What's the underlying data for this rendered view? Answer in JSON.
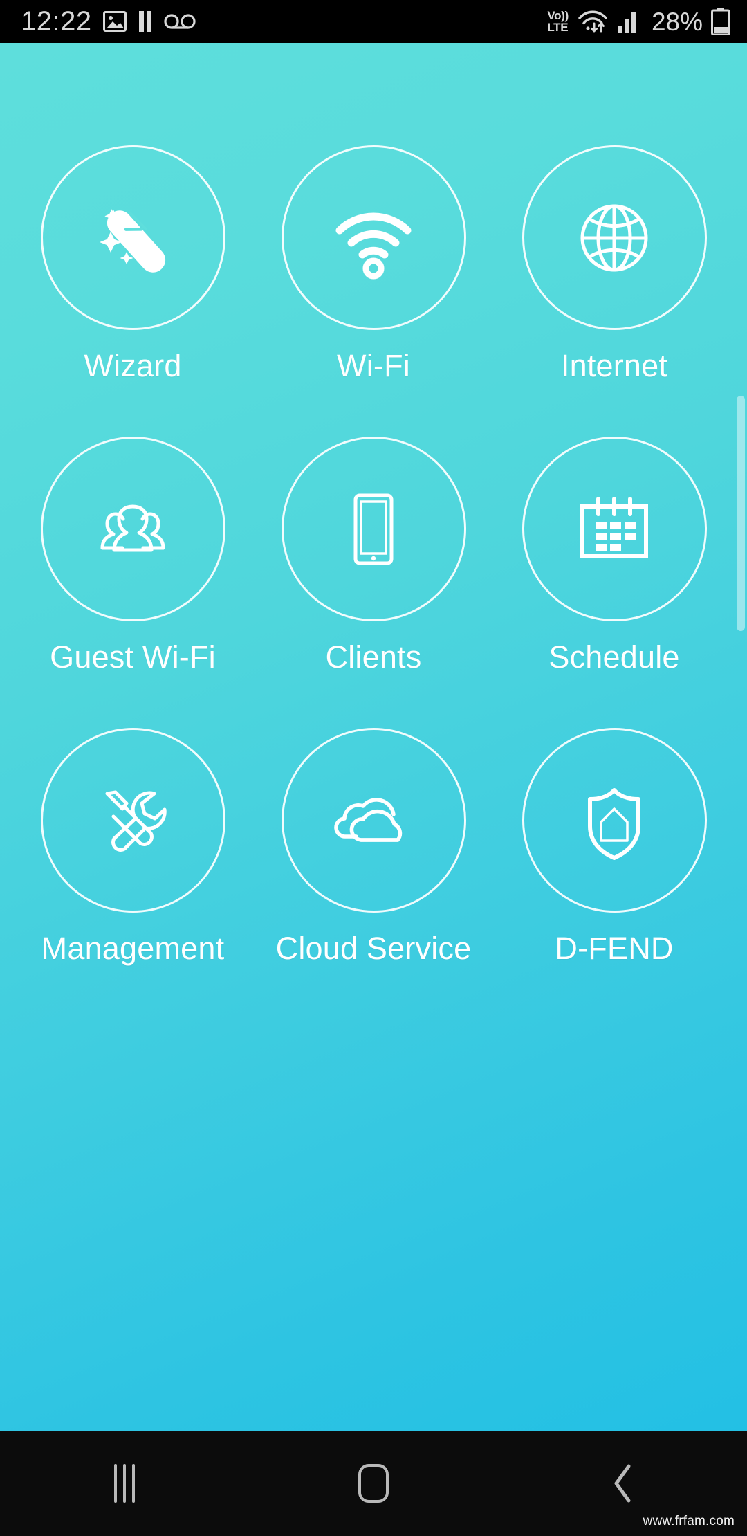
{
  "status_bar": {
    "clock": "12:22",
    "left_icons": [
      {
        "name": "screenshot-icon",
        "label": "Screenshot"
      },
      {
        "name": "media-pause-icon",
        "label": "Paused"
      },
      {
        "name": "voicemail-icon",
        "label": "Voicemail"
      }
    ],
    "volte": {
      "line1": "Vo))",
      "line2": "LTE"
    },
    "wifi_icon": "wifi-data-transfer-icon",
    "signal_icon": "cellular-signal-icon",
    "battery_percent": "28%",
    "battery_icon": "battery-icon"
  },
  "home": {
    "tiles": [
      {
        "id": "wizard",
        "label": "Wizard",
        "icon": "magic-wand-icon"
      },
      {
        "id": "wifi",
        "label": "Wi-Fi",
        "icon": "wifi-icon"
      },
      {
        "id": "internet",
        "label": "Internet",
        "icon": "globe-icon"
      },
      {
        "id": "guest-wifi",
        "label": "Guest Wi-Fi",
        "icon": "group-people-icon"
      },
      {
        "id": "clients",
        "label": "Clients",
        "icon": "tablet-device-icon"
      },
      {
        "id": "schedule",
        "label": "Schedule",
        "icon": "calendar-icon"
      },
      {
        "id": "management",
        "label": "Management",
        "icon": "tools-wrench-screwdriver-icon"
      },
      {
        "id": "cloud-service",
        "label": "Cloud Service",
        "icon": "clouds-icon"
      },
      {
        "id": "d-fend",
        "label": "D-FEND",
        "icon": "shield-home-icon"
      }
    ],
    "colors": {
      "gradient_top": "#5EDEDC",
      "gradient_bottom": "#23C0E4",
      "icon_stroke": "#FFFFFF",
      "label_color": "#FFFFFF"
    }
  },
  "nav_bar": {
    "recent_label": "Recent apps",
    "home_label": "Home",
    "back_label": "Back"
  },
  "watermark": "www.frfam.com"
}
